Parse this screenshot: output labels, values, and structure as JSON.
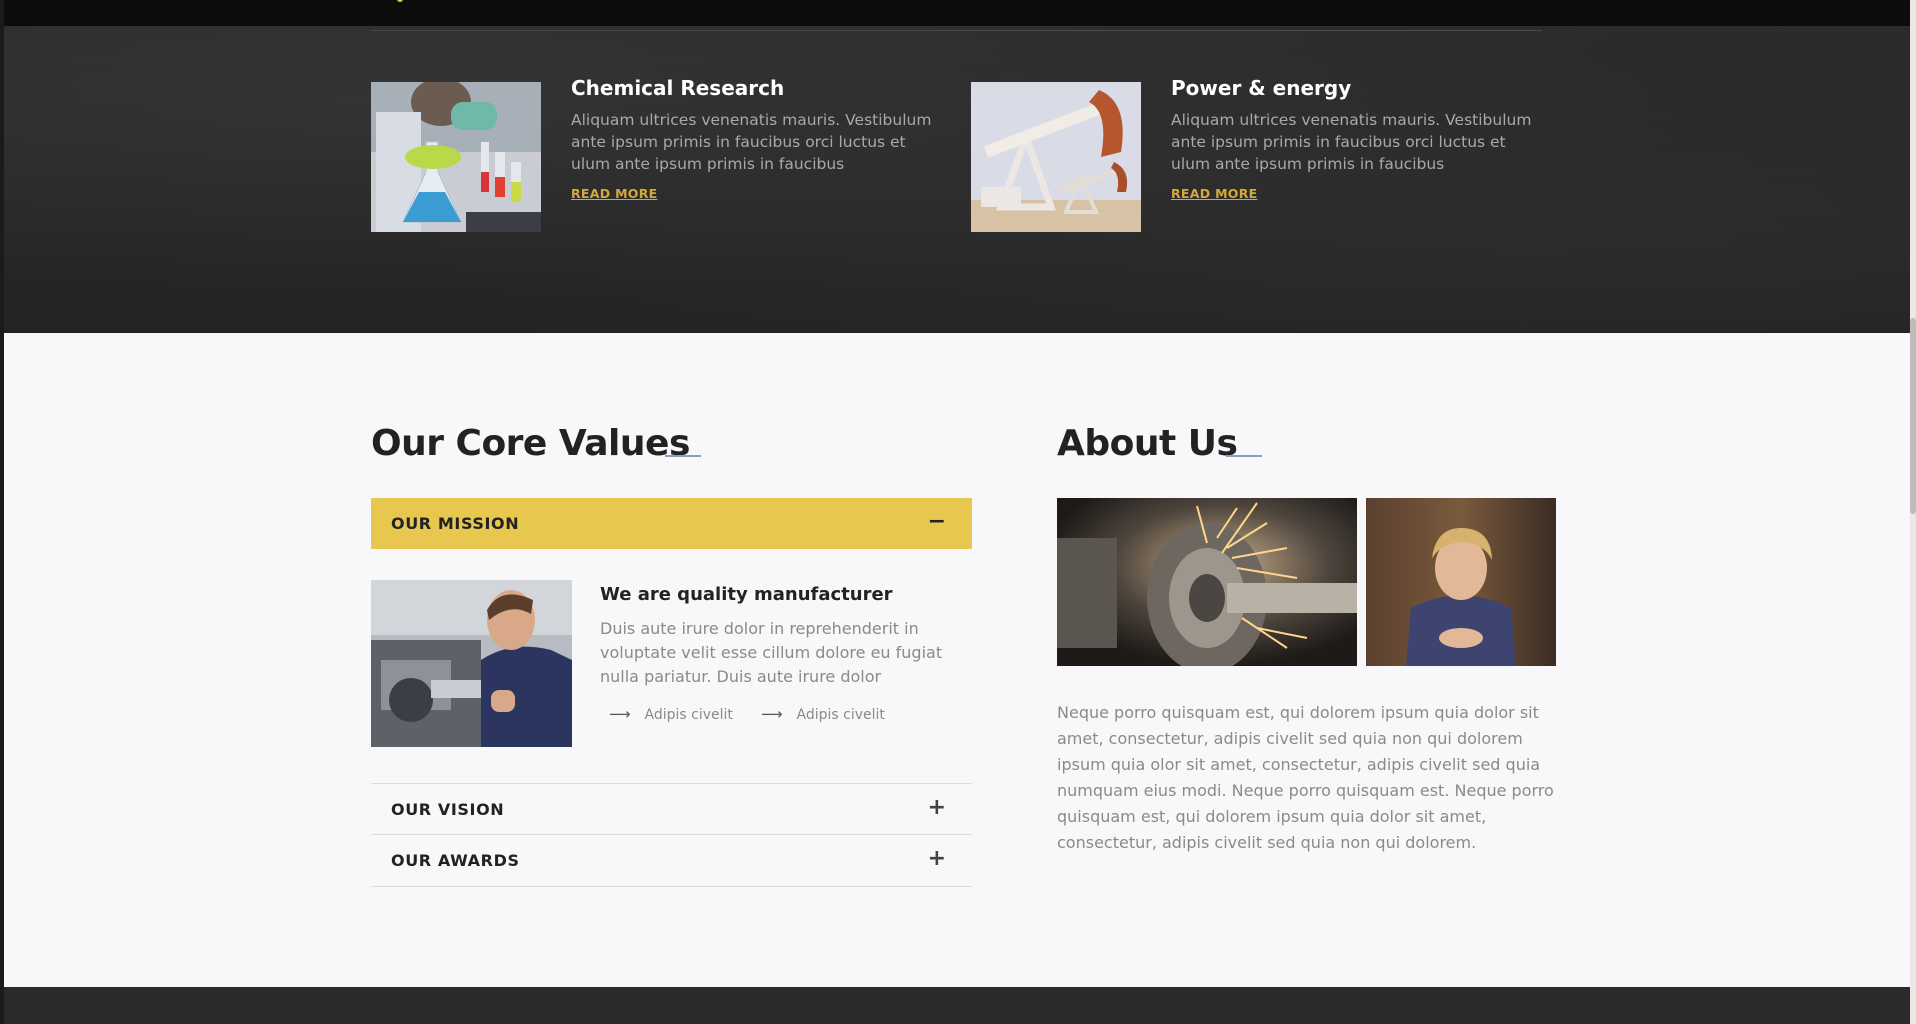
{
  "services": [
    {
      "title": "Chemical Research",
      "text": "Aliquam ultrices venenatis mauris. Vestibulum ante ipsum primis in faucibus orci luctus et ulum ante ipsum primis in faucibus",
      "link": "READ MORE",
      "image": "chemistry-lab-photo"
    },
    {
      "title": "Power & energy",
      "text": "Aliquam ultrices venenatis mauris. Vestibulum ante ipsum primis in faucibus orci luctus et ulum ante ipsum primis in faucibus",
      "link": "READ MORE",
      "image": "oil-pump-photo"
    }
  ],
  "core_values": {
    "heading": "Our Core Values",
    "tabs": [
      {
        "label": "OUR MISSION",
        "sign": "−",
        "expanded": true
      },
      {
        "label": "OUR VISION",
        "sign": "+",
        "expanded": false
      },
      {
        "label": "OUR AWARDS",
        "sign": "+",
        "expanded": false
      }
    ],
    "mission": {
      "title": "We are quality manufacturer",
      "text": "Duis aute irure dolor in reprehenderit in voluptate velit esse cillum dolore eu fugiat nulla pariatur. Duis aute irure dolor",
      "bullets": [
        "Adipis civelit",
        "Adipis civelit"
      ],
      "bullet_icon": "arrow-right-icon"
    }
  },
  "about": {
    "heading": "About Us",
    "text": "Neque porro quisquam est, qui dolorem ipsum quia dolor sit amet, consectetur, adipis civelit sed quia non qui dolorem ipsum quia olor sit amet, consectetur, adipis civelit sed quia numquam eius modi. Neque porro quisquam est. Neque porro quisquam est, qui dolorem ipsum quia dolor sit amet, consectetur, adipis civelit sed quia non qui dolorem."
  },
  "colors": {
    "accent": "#e8c74f",
    "link": "#d4a93c",
    "heading_line": "#7fa3c0",
    "dark_bg": "#272727"
  }
}
